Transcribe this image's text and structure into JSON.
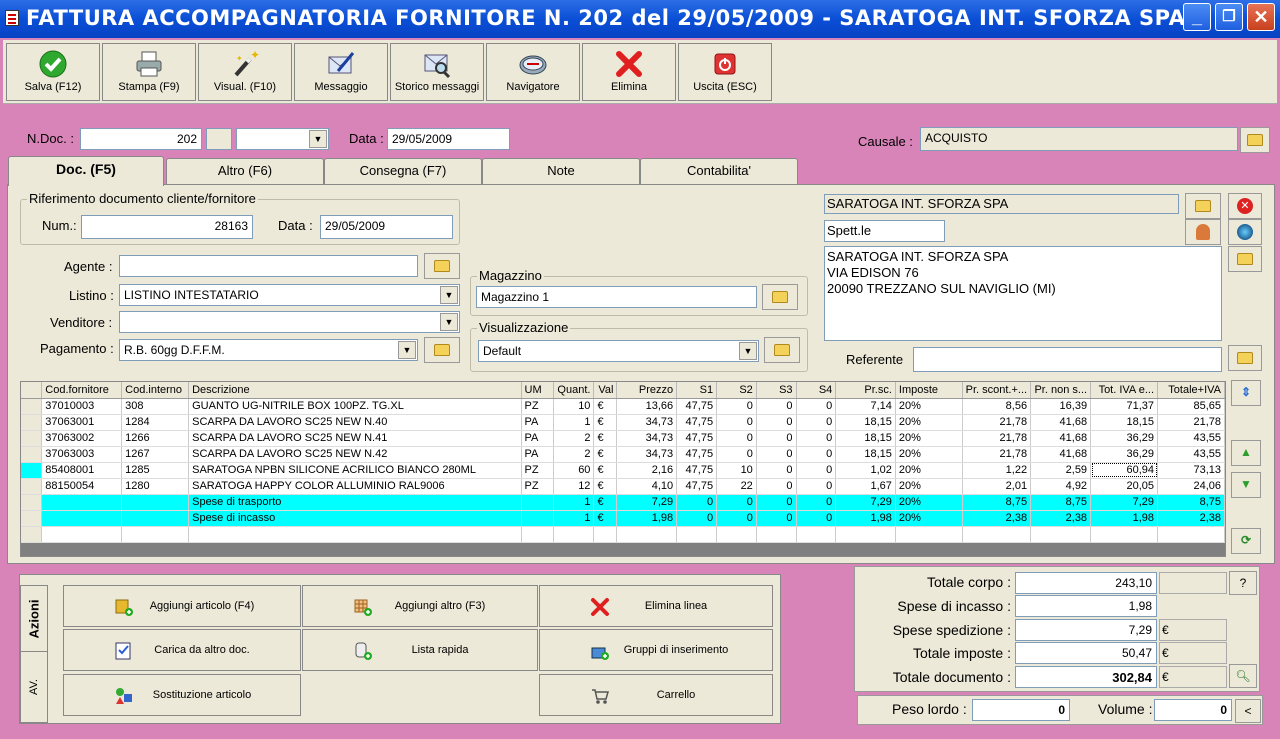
{
  "window": {
    "title": "FATTURA ACCOMPAGNATORIA FORNITORE N. 202  del 29/05/2009 - SARATOGA INT. SFORZA SPA",
    "min": "_",
    "max": "❐",
    "close": "✕"
  },
  "toolbar": [
    {
      "label": "Salva (F12)",
      "icon": "check-icon"
    },
    {
      "label": "Stampa (F9)",
      "icon": "printer-icon"
    },
    {
      "label": "Visual. (F10)",
      "icon": "magic-wand-icon"
    },
    {
      "label": "Messaggio",
      "icon": "envelope-pen-icon"
    },
    {
      "label": "Storico messaggi",
      "icon": "envelope-search-icon"
    },
    {
      "label": "Navigatore",
      "icon": "compass-icon"
    },
    {
      "label": "Elimina",
      "icon": "red-x-icon"
    },
    {
      "label": "Uscita (ESC)",
      "icon": "power-icon"
    }
  ],
  "header": {
    "ndoc_label": "N.Doc. :",
    "ndoc_value": "202",
    "data_label": "Data :",
    "data_value": "29/05/2009",
    "causale_label": "Causale :",
    "causale_value": "ACQUISTO"
  },
  "tabs": [
    "Doc. (F5)",
    "Altro (F6)",
    "Consegna (F7)",
    "Note",
    "Contabilita'"
  ],
  "riferimento": {
    "title": "Riferimento documento cliente/fornitore",
    "num_label": "Num.:",
    "num_value": "28163",
    "data_label": "Data :",
    "data_value": "29/05/2009"
  },
  "form": {
    "agente_label": "Agente :",
    "agente_value": "",
    "listino_label": "Listino :",
    "listino_value": "LISTINO INTESTATARIO",
    "venditore_label": "Venditore :",
    "venditore_value": "",
    "pagamento_label": "Pagamento :",
    "pagamento_value": "R.B. 60gg D.F.F.M.",
    "magazzino_title": "Magazzino",
    "magazzino_value": "Magazzino 1",
    "visualizzazione_title": "Visualizzazione",
    "visualizzazione_value": "Default"
  },
  "intestatario": {
    "name": "SARATOGA INT. SFORZA SPA",
    "spett": "Spett.le",
    "address": [
      "SARATOGA INT. SFORZA SPA",
      "VIA EDISON 76",
      "20090 TREZZANO SUL NAVIGLIO (MI)"
    ],
    "referente_label": "Referente",
    "referente_value": ""
  },
  "grid": {
    "columns": [
      "Cod.fornitore",
      "Cod.interno",
      "Descrizione",
      "UM",
      "Quant.",
      "Val",
      "Prezzo",
      "S1",
      "S2",
      "S3",
      "S4",
      "Pr.sc.",
      "Imposte",
      "Pr. scont.+...",
      "Pr. non s...",
      "Tot. IVA e...",
      "Totale+IVA"
    ],
    "rows": [
      [
        "37010003",
        "308",
        "GUANTO UG-NITRILE BOX 100PZ. TG.XL",
        "PZ",
        "10",
        "€",
        "13,66",
        "47,75",
        "0",
        "0",
        "0",
        "7,14",
        "20%",
        "8,56",
        "16,39",
        "71,37",
        "85,65"
      ],
      [
        "37063001",
        "1284",
        "SCARPA DA LAVORO SC25 NEW N.40",
        "PA",
        "1",
        "€",
        "34,73",
        "47,75",
        "0",
        "0",
        "0",
        "18,15",
        "20%",
        "21,78",
        "41,68",
        "18,15",
        "21,78"
      ],
      [
        "37063002",
        "1266",
        "SCARPA DA LAVORO SC25 NEW N.41",
        "PA",
        "2",
        "€",
        "34,73",
        "47,75",
        "0",
        "0",
        "0",
        "18,15",
        "20%",
        "21,78",
        "41,68",
        "36,29",
        "43,55"
      ],
      [
        "37063003",
        "1267",
        "SCARPA DA LAVORO SC25 NEW N.42",
        "PA",
        "2",
        "€",
        "34,73",
        "47,75",
        "0",
        "0",
        "0",
        "18,15",
        "20%",
        "21,78",
        "41,68",
        "36,29",
        "43,55"
      ],
      [
        "85408001",
        "1285",
        "SARATOGA NPBN SILICONE ACRILICO BIANCO 280ML",
        "PZ",
        "60",
        "€",
        "2,16",
        "47,75",
        "10",
        "0",
        "0",
        "1,02",
        "20%",
        "1,22",
        "2,59",
        "60,94",
        "73,13"
      ],
      [
        "88150054",
        "1280",
        "SARATOGA HAPPY COLOR ALLUMINIO RAL9006",
        "PZ",
        "12",
        "€",
        "4,10",
        "47,75",
        "22",
        "0",
        "0",
        "1,67",
        "20%",
        "2,01",
        "4,92",
        "20,05",
        "24,06"
      ],
      [
        "",
        "",
        "Spese di trasporto",
        "",
        "1",
        "€",
        "7,29",
        "0",
        "0",
        "0",
        "0",
        "7,29",
        "20%",
        "8,75",
        "8,75",
        "7,29",
        "8,75"
      ],
      [
        "",
        "",
        "Spese di incasso",
        "",
        "1",
        "€",
        "1,98",
        "0",
        "0",
        "0",
        "0",
        "1,98",
        "20%",
        "2,38",
        "2,38",
        "1,98",
        "2,38"
      ]
    ]
  },
  "azioni": {
    "tab_azioni": "Azioni",
    "tab_av": "AV.",
    "buttons": [
      "Aggiungi articolo (F4)",
      "Aggiungi altro (F3)",
      "Elimina linea",
      "Carica da altro doc.",
      "Lista rapida",
      "Gruppi di inserimento",
      "Sostituzione articolo",
      "Carrello"
    ]
  },
  "totali": {
    "corpo_label": "Totale corpo :",
    "corpo_value": "243,10",
    "incasso_label": "Spese di incasso :",
    "incasso_value": "1,98",
    "spedizione_label": "Spese spedizione :",
    "spedizione_value": "7,29",
    "spedizione_cur": "€",
    "imposte_label": "Totale imposte :",
    "imposte_value": "50,47",
    "imposte_cur": "€",
    "documento_label": "Totale documento :",
    "documento_value": "302,84",
    "documento_cur": "€",
    "help": "?"
  },
  "pesi": {
    "peso_label": "Peso lordo :",
    "peso_value": "0",
    "volume_label": "Volume :",
    "volume_value": "0",
    "nav": "<"
  }
}
